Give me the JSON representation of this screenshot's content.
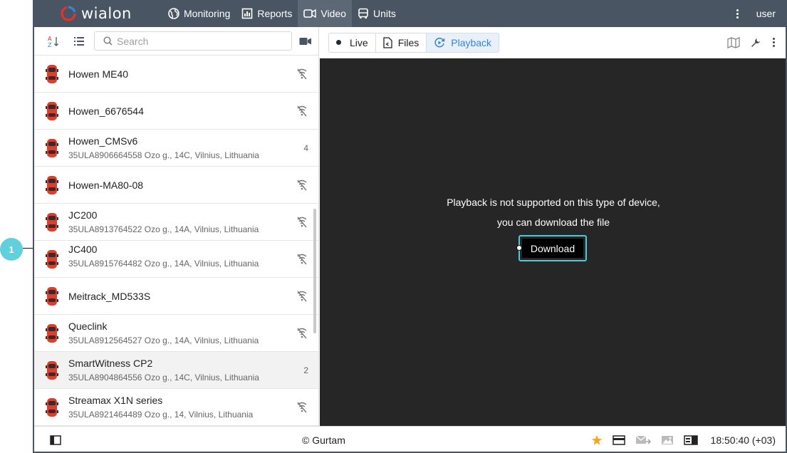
{
  "app": {
    "logo_text": "wialon",
    "nav": [
      {
        "label": "Monitoring",
        "icon": "globe-icon"
      },
      {
        "label": "Reports",
        "icon": "reports-icon"
      },
      {
        "label": "Video",
        "icon": "video-icon",
        "active": true
      },
      {
        "label": "Units",
        "icon": "bus-icon"
      }
    ],
    "user": "user"
  },
  "left": {
    "search_placeholder": "Search",
    "units": [
      {
        "name": "Howen ME40",
        "address": "",
        "right": ""
      },
      {
        "name": "Howen_6676544",
        "address": "",
        "right": ""
      },
      {
        "name": "Howen_CMSv6",
        "address": "35ULA8906664558 Ozo g., 14C, Vilnius, Lithuania",
        "right": "4"
      },
      {
        "name": "Howen-MA80-08",
        "address": "",
        "right": ""
      },
      {
        "name": "JC200",
        "address": "35ULA8913764522 Ozo g., 14A, Vilnius, Lithuania",
        "right": ""
      },
      {
        "name": "JC400",
        "address": "35ULA8915764482 Ozo g., 14A, Vilnius, Lithuania",
        "right": ""
      },
      {
        "name": "Meitrack_MD533S",
        "address": "",
        "right": ""
      },
      {
        "name": "Queclink",
        "address": "35ULA8912564527 Ozo g., 14A, Vilnius, Lithuania",
        "right": ""
      },
      {
        "name": "SmartWitness CP2",
        "address": "35ULA8904864556 Ozo g., 14C, Vilnius, Lithuania",
        "right": "2"
      },
      {
        "name": "Streamax X1N series",
        "address": "35ULA8921464489 Ozo g., 14, Vilnius, Lithuania",
        "right": ""
      }
    ]
  },
  "right": {
    "modes": [
      {
        "label": "Live",
        "icon": "dot-icon"
      },
      {
        "label": "Files",
        "icon": "file-icon"
      },
      {
        "label": "Playback",
        "icon": "playback-icon",
        "active": true
      }
    ],
    "message_line1": "Playback is not supported on this type of device,",
    "message_line2": "you can download the file",
    "download_label": "Download"
  },
  "footer": {
    "copyright": "© Gurtam",
    "time": "18:50:40 (+03)"
  },
  "callout": {
    "number": "1"
  },
  "colors": {
    "topbar": "#4a5563",
    "accent": "#3b82d6",
    "callout": "#5fd0dc",
    "video_bg": "#262626"
  }
}
